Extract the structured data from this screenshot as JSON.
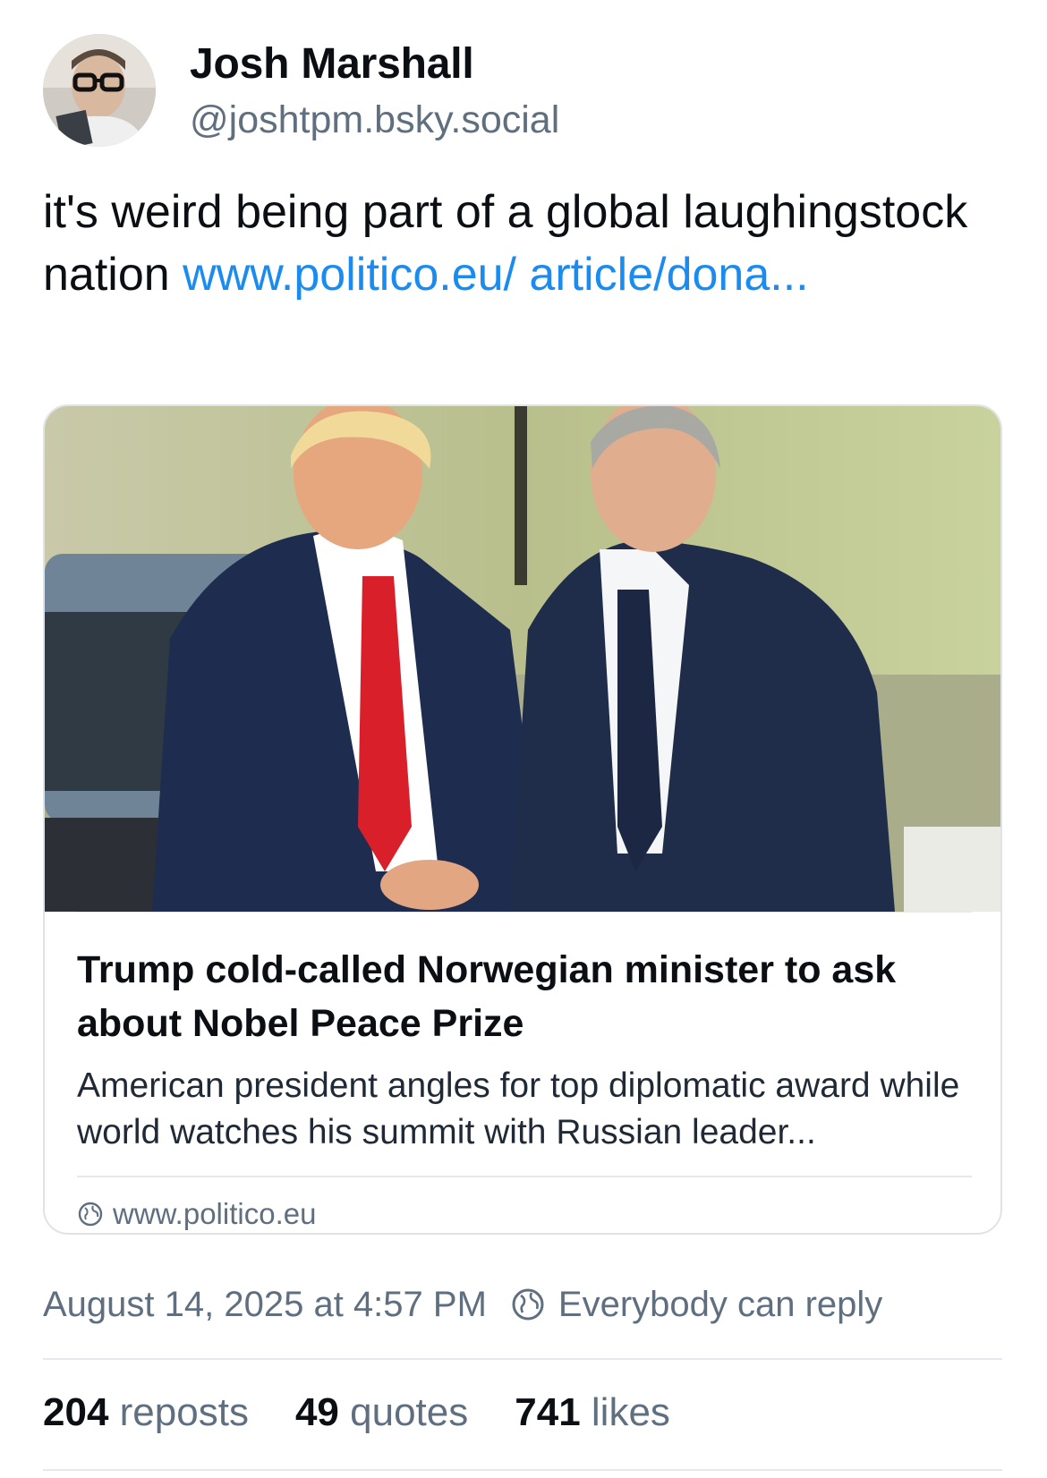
{
  "author": {
    "display_name": "Josh Marshall",
    "handle": "@joshtpm.bsky.social",
    "avatar_icon": "profile-photo"
  },
  "post": {
    "text": "it's weird being part of a global laughingstock nation ",
    "link_text": "www.politico.eu/ article/dona..."
  },
  "embed": {
    "image_icon": "article-photo-handshake",
    "title": "Trump cold-called Norwegian minister to ask about Nobel Peace Prize",
    "description": "American president angles for top diplomatic award while world watches his summit with Russian leader...",
    "domain": "www.politico.eu",
    "domain_icon": "globe-icon"
  },
  "meta": {
    "timestamp": "August 14, 2025 at 4:57 PM",
    "reply_setting": "Everybody can reply",
    "reply_icon": "globe-icon"
  },
  "stats": {
    "reposts_count": "204",
    "reposts_label": "reposts",
    "quotes_count": "49",
    "quotes_label": "quotes",
    "likes_count": "741",
    "likes_label": "likes"
  },
  "colors": {
    "link": "#1a8cf0",
    "secondary_text": "#5f6f80",
    "primary_text": "#0b0f14",
    "border": "#dfe3e8"
  }
}
